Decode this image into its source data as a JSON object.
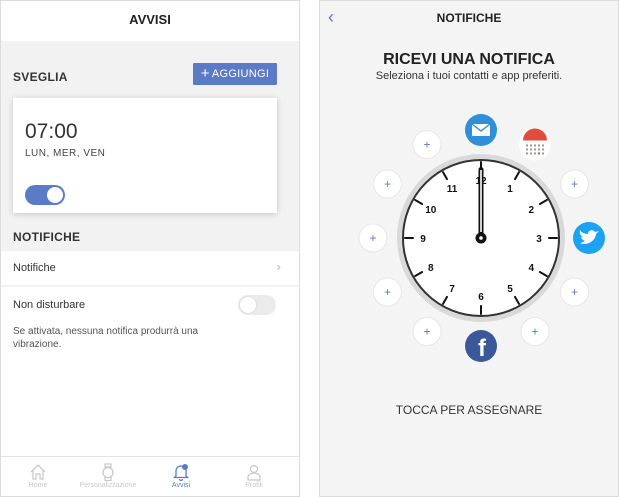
{
  "left": {
    "title": "AVVISI",
    "alarm_section": "SVEGLIA",
    "add_label": "AGGIUNGI",
    "alarm": {
      "time": "07:00",
      "days": "LUN, MER, VEN",
      "enabled": true
    },
    "notifications_section": "NOTIFICHE",
    "notifications_row": "Notifiche",
    "dnd_label": "Non disturbare",
    "dnd_enabled": false,
    "dnd_description": "Se attivata, nessuna notifica produrrà una vibrazione.",
    "tabs": [
      {
        "label": "Home",
        "icon": "home-icon",
        "active": false
      },
      {
        "label": "Personalizzazione",
        "icon": "watch-icon",
        "active": false
      },
      {
        "label": "Avvisi",
        "icon": "bell-icon",
        "active": true
      },
      {
        "label": "Profili",
        "icon": "person-icon",
        "active": false
      }
    ]
  },
  "right": {
    "title": "NOTIFICHE",
    "heading": "RICEVI UNA NOTIFICA",
    "subheading": "Seleziona i tuoi contatti e app preferiti.",
    "clock_numbers": [
      "12",
      "1",
      "2",
      "3",
      "4",
      "5",
      "6",
      "7",
      "8",
      "9",
      "10",
      "11"
    ],
    "assigned_apps": [
      {
        "position": "12",
        "icon": "mail-icon"
      },
      {
        "position": "1",
        "icon": "calendar-icon"
      },
      {
        "position": "3",
        "icon": "twitter-icon"
      },
      {
        "position": "6",
        "icon": "facebook-icon"
      }
    ],
    "footer": "TOCCA PER ASSEGNARE"
  },
  "colors": {
    "accent": "#5b7bc6",
    "mail": "#2f8fd8",
    "twitter": "#1da1f2",
    "facebook": "#3b5998",
    "calendar": "#e24c3c"
  }
}
